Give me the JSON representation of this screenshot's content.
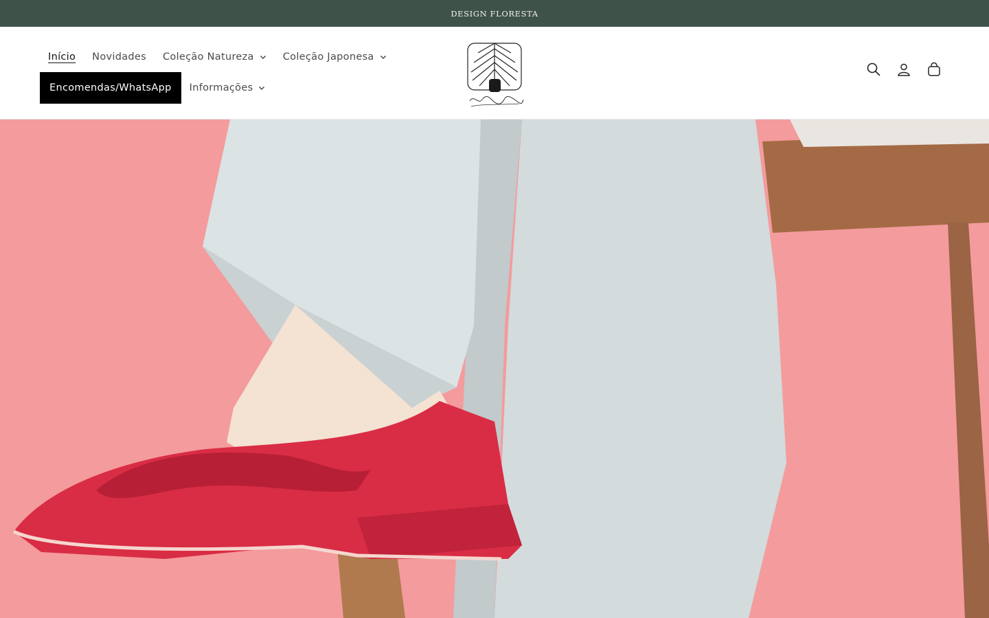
{
  "announcement": {
    "text": "DESIGN FLORESTA"
  },
  "nav": {
    "items": [
      {
        "label": "Início"
      },
      {
        "label": "Novidades"
      },
      {
        "label": "Coleção Natureza"
      },
      {
        "label": "Coleção Japonesa"
      },
      {
        "label": "Encomendas/WhatsApp"
      },
      {
        "label": "Informações"
      }
    ]
  },
  "header_icons": [
    "search-icon",
    "account-icon",
    "cart-icon"
  ],
  "colors": {
    "announcement_bg": "#3f524a",
    "hero_bg": "#f49b9d",
    "shoe_red": "#d92d45",
    "highlight_bg": "#000000"
  }
}
